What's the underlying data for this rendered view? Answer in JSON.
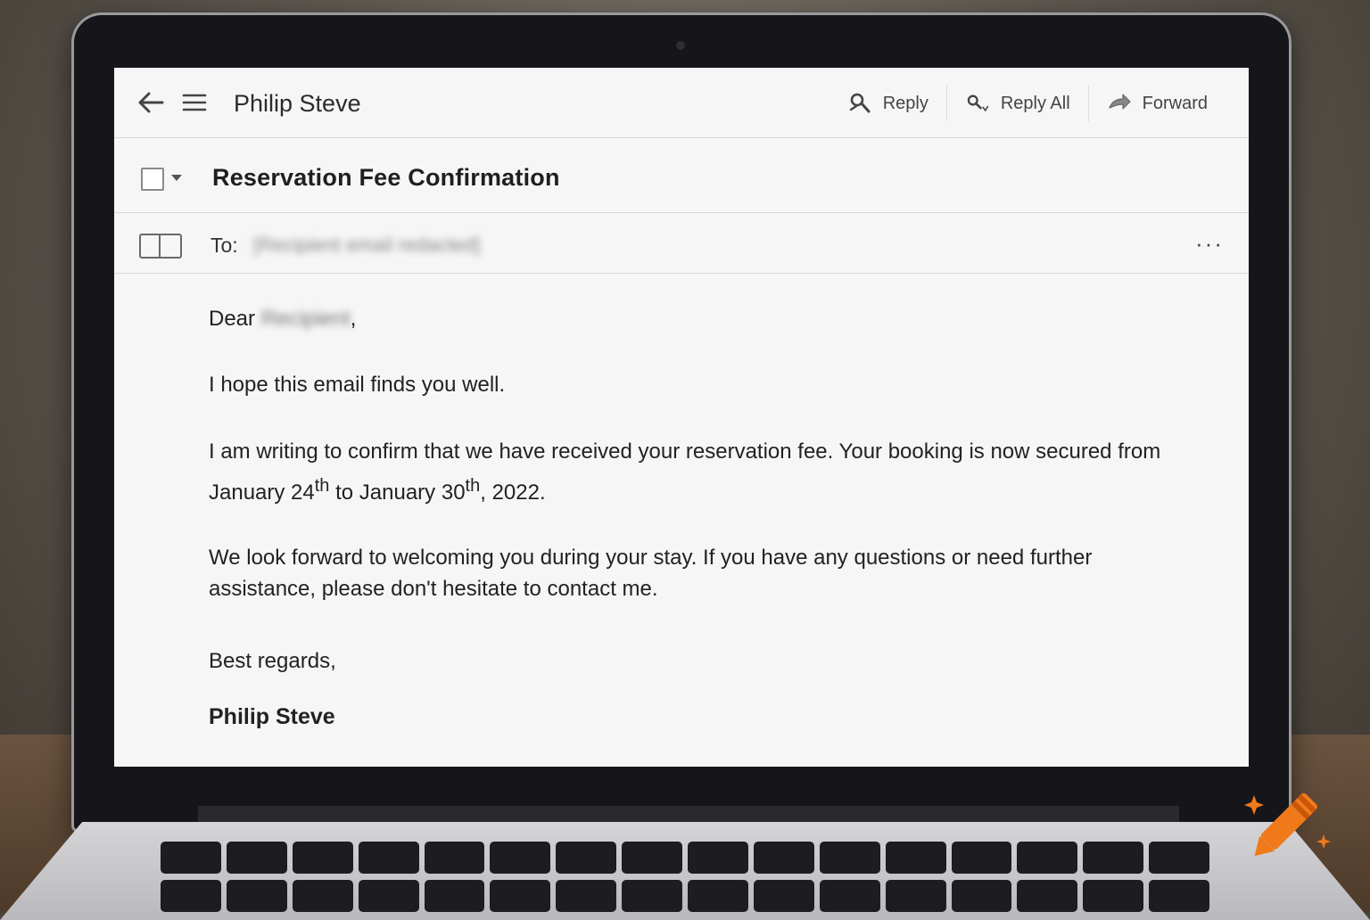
{
  "toolbar": {
    "sender_name": "Philip Steve",
    "actions": [
      {
        "label": "Reply",
        "icon": "reply-icon"
      },
      {
        "label": "Reply All",
        "icon": "reply-all-icon"
      },
      {
        "label": "Forward",
        "icon": "forward-icon"
      }
    ]
  },
  "subject_row": {
    "subject": "Reservation Fee Confirmation"
  },
  "to_row": {
    "label": "To:",
    "value": "[Recipient email redacted]",
    "more": "···"
  },
  "body": {
    "greeting_prefix": "Dear",
    "greeting_name": "Recipient",
    "greeting_suffix": ",",
    "paragraph_1": "I hope this email finds you well.",
    "paragraph_2_part1": "I am writing to confirm that we have received your reservation fee. Your booking is now secured from January 24",
    "paragraph_2_sup1": "th",
    "paragraph_2_part2": " to January 30",
    "paragraph_2_sup2": "th",
    "paragraph_2_part3": ", 2022.",
    "paragraph_3": "We look forward to welcoming you during your stay. If you have any questions or need further assistance, please don't hesitate to contact me.",
    "closing": "Best regards,",
    "signature": "Philip Steve"
  },
  "colors": {
    "screen_bg": "#f6f6f6",
    "text": "#222222",
    "divider": "#d8d8d8",
    "logo_orange": "#f07a1a"
  }
}
